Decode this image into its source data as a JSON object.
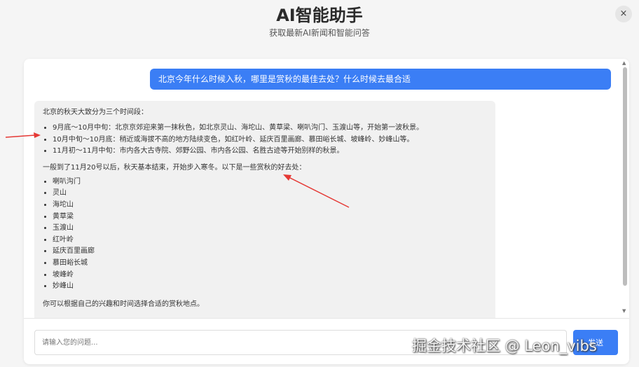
{
  "header": {
    "title": "AI智能助手",
    "subtitle": "获取最新AI新闻和智能问答",
    "close_icon": "×"
  },
  "chat": {
    "user_message": "北京今年什么时候入秋，哪里是赏秋的最佳去处？什么时候去最合适",
    "bot_message": {
      "intro": "北京的秋天大致分为三个时间段：",
      "periods": [
        "9月底～10月中旬：北京京郊迎来第一抹秋色，如北京灵山、海坨山、黄草梁、喇叭沟门、玉渡山等，开始第一波秋景。",
        "10月中旬～10月底：稍近或海拔不高的地方陆续变色，如红叶岭、延庆百里画廊、慕田峪长城、坡峰岭、妙峰山等。",
        "11月初～11月中旬：市内各大古寺院、郊野公园、市内各公园、名胜古迹等开始别样的秋景。"
      ],
      "middle": "一般到了11月20号以后，秋天基本结束，开始步入寒冬。以下是一些赏秋的好去处：",
      "spots": [
        "喇叭沟门",
        "灵山",
        "海坨山",
        "黄草梁",
        "玉渡山",
        "红叶岭",
        "延庆百里画廊",
        "慕田峪长城",
        "坡峰岭",
        "妙峰山"
      ],
      "closing": "你可以根据自己的兴趣和时间选择合适的赏秋地点。"
    }
  },
  "input": {
    "placeholder": "请输入您的问题...",
    "value": ""
  },
  "send_button": {
    "label": "发送"
  },
  "scrollbar": {
    "up_icon": "▲",
    "down_icon": "▼"
  },
  "watermark": "掘金技术社区 @ Leon_vibs",
  "colors": {
    "accent": "#3b7ef5",
    "bot_bubble": "#f1f1f1",
    "annotation_arrow": "#e53935"
  }
}
